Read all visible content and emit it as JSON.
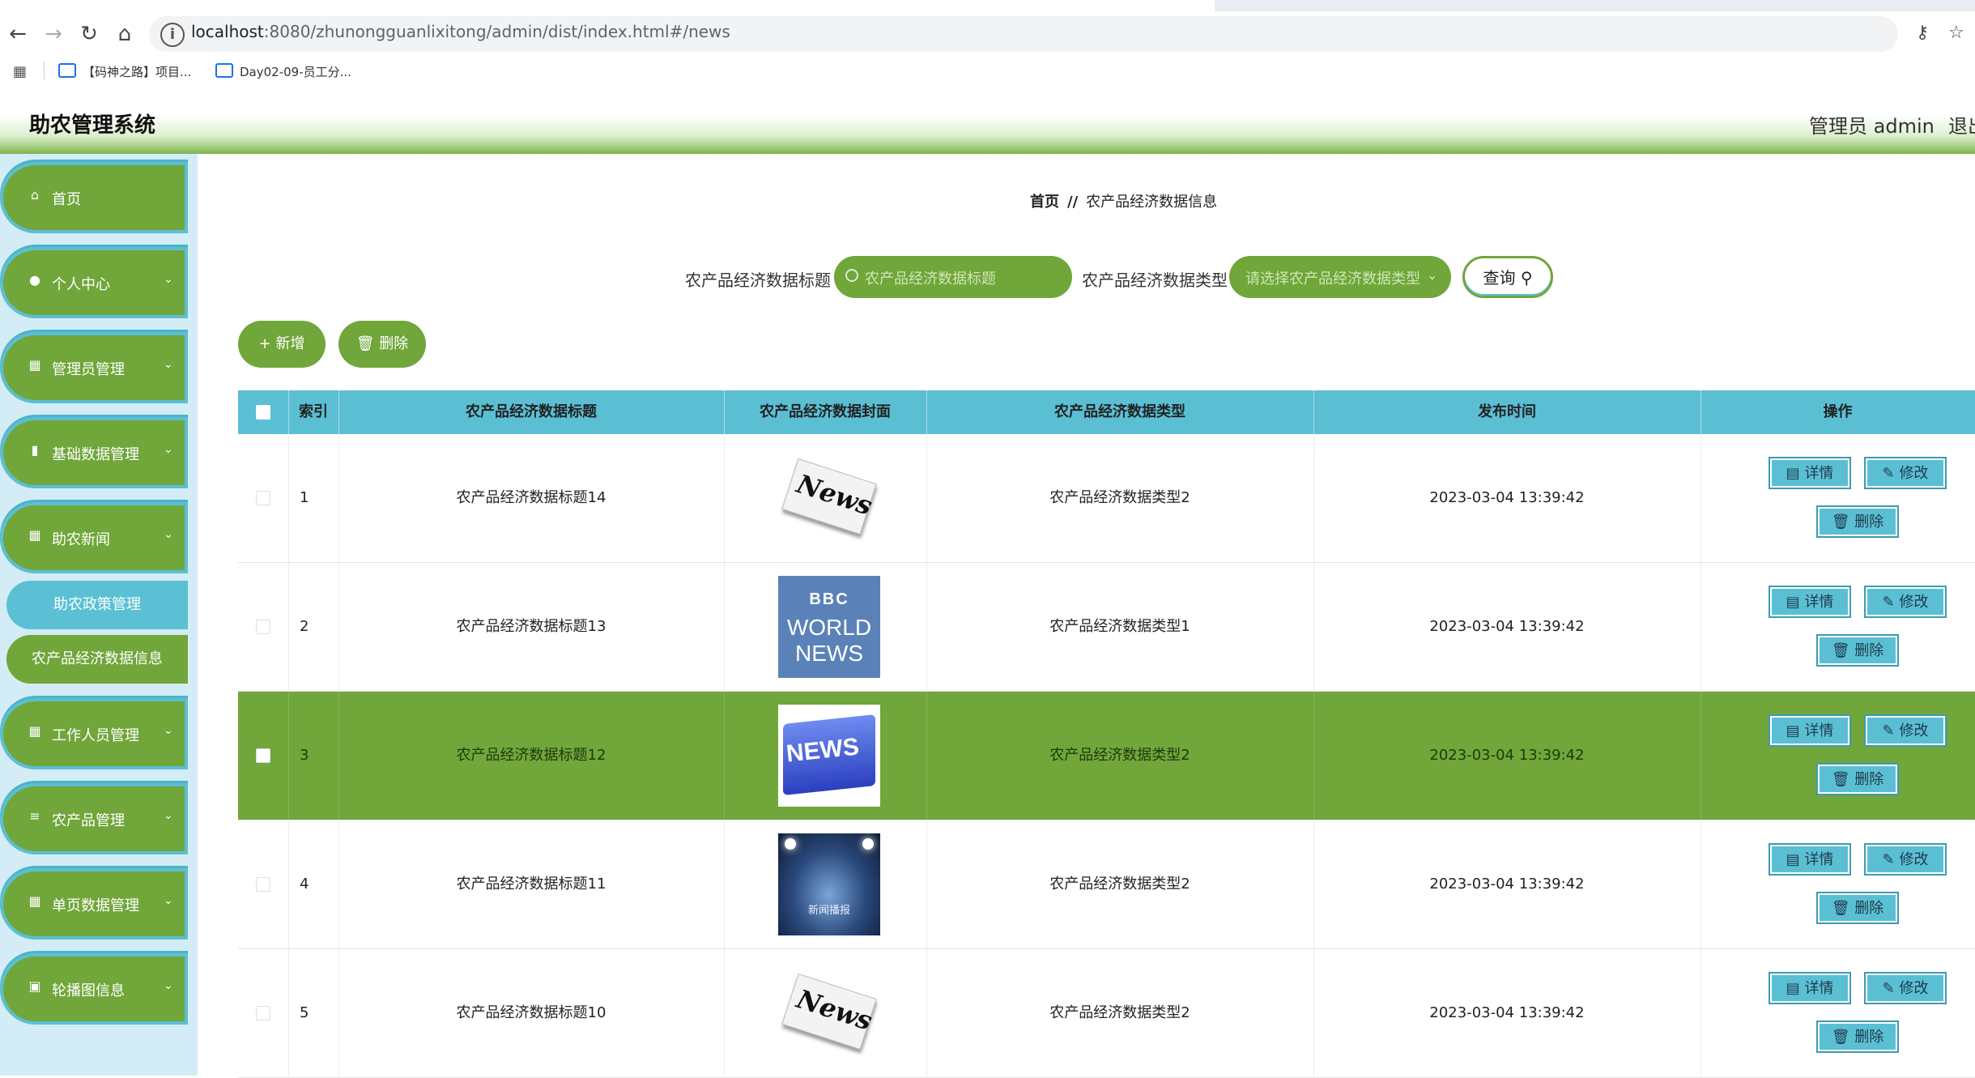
{
  "browser": {
    "url_host": "localhost",
    "url_path": ":8080/zhunongguanlixitong/admin/dist/index.html#/news",
    "bookmarks": [
      {
        "label": "【码神之路】项目..."
      },
      {
        "label": "Day02-09-员工分..."
      }
    ]
  },
  "header": {
    "title": "助农管理系统",
    "user": "管理员 admin",
    "logout": "退出"
  },
  "sidebar": {
    "items": [
      {
        "label": "首页",
        "icon": "home-icon"
      },
      {
        "label": "个人中心",
        "icon": "user-icon"
      },
      {
        "label": "管理员管理",
        "icon": "grid-icon"
      },
      {
        "label": "基础数据管理",
        "icon": "database-icon"
      },
      {
        "label": "助农新闻",
        "icon": "grid-icon"
      },
      {
        "label": "工作人员管理",
        "icon": "grid-icon"
      },
      {
        "label": "农产品管理",
        "icon": "sliders-icon"
      },
      {
        "label": "单页数据管理",
        "icon": "grid-icon"
      },
      {
        "label": "轮播图信息",
        "icon": "image-icon"
      }
    ],
    "submenu": [
      {
        "label": "助农政策管理"
      },
      {
        "label": "农产品经济数据信息"
      }
    ]
  },
  "breadcrumb": {
    "home": "首页",
    "separator": "//",
    "current": "农产品经济数据信息"
  },
  "search": {
    "title_label": "农产品经济数据标题",
    "title_placeholder": "农产品经济数据标题",
    "type_label": "农产品经济数据类型",
    "type_placeholder": "请选择农产品经济数据类型",
    "query_label": "查询"
  },
  "toolbar": {
    "add_label": "新增",
    "delete_label": "删除"
  },
  "table": {
    "headers": [
      "索引",
      "农产品经济数据标题",
      "农产品经济数据封面",
      "农产品经济数据类型",
      "发布时间",
      "操作"
    ],
    "rows": [
      {
        "index": "1",
        "title": "农产品经济数据标题14",
        "cover": "news-paper",
        "type": "农产品经济数据类型2",
        "time": "2023-03-04 13:39:42"
      },
      {
        "index": "2",
        "title": "农产品经济数据标题13",
        "cover": "bbc-world-news",
        "type": "农产品经济数据类型1",
        "time": "2023-03-04 13:39:42"
      },
      {
        "index": "3",
        "title": "农产品经济数据标题12",
        "cover": "news-key",
        "type": "农产品经济数据类型2",
        "time": "2023-03-04 13:39:42"
      },
      {
        "index": "4",
        "title": "农产品经济数据标题11",
        "cover": "news-stage",
        "type": "农产品经济数据类型2",
        "time": "2023-03-04 13:39:42"
      },
      {
        "index": "5",
        "title": "农产品经济数据标题10",
        "cover": "news-paper",
        "type": "农产品经济数据类型2",
        "time": "2023-03-04 13:39:42"
      }
    ],
    "actions": {
      "detail": "详情",
      "edit": "修改",
      "delete": "删除"
    }
  },
  "covers": {
    "paper_word": "News",
    "bbc_line1": "BBC",
    "bbc_line2": "WORLD",
    "bbc_line3": "NEWS",
    "key_word": "NEWS",
    "stage_text": "新闻播报"
  },
  "colors": {
    "accent_green": "#70a63a",
    "accent_cyan": "#5bbfd4",
    "sidebar_bg": "#d4ecf6"
  }
}
